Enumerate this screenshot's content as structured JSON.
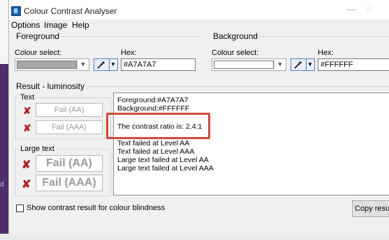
{
  "app": {
    "title": "Colour Contrast Analyser",
    "minimize": "—",
    "maximize": "☐"
  },
  "menu": [
    "Options",
    "Image",
    "Help"
  ],
  "background_fragment": "d",
  "foreground": {
    "group_label": "Foreground",
    "colour_select_label": "Colour select:",
    "hex_label": "Hex:",
    "hex_value": "#A7A7A7",
    "swatch_color": "#a7a7a7"
  },
  "background": {
    "group_label": "Background",
    "colour_select_label": "Colour select:",
    "hex_label": "Hex:",
    "hex_value": "#FFFFFF",
    "swatch_color": "#ffffff"
  },
  "result": {
    "group_label": "Result - luminosity",
    "text_label": "Text",
    "large_text_label": "Large text",
    "text_aa": "Fail (AA)",
    "text_aaa": "Fail (AAA)",
    "large_aa": "Fail (AA)",
    "large_aaa": "Fail (AAA)",
    "fail_icon": "✘",
    "lines": [
      "Foreground:#A7A7A7",
      "Background:#FFFFFF",
      "",
      "The contrast ratio is: 2.4:1",
      "",
      "Text failed at Level AA",
      "Text failed at Level AAA",
      "Large text failed at Level AA",
      "Large text failed at Level AAA"
    ]
  },
  "colour_blindness_label": "Show contrast result for colour blindness",
  "copy_button": "Copy results",
  "colors": {
    "highlight": "#d34a3a",
    "fail_red": "#b01e1e"
  }
}
